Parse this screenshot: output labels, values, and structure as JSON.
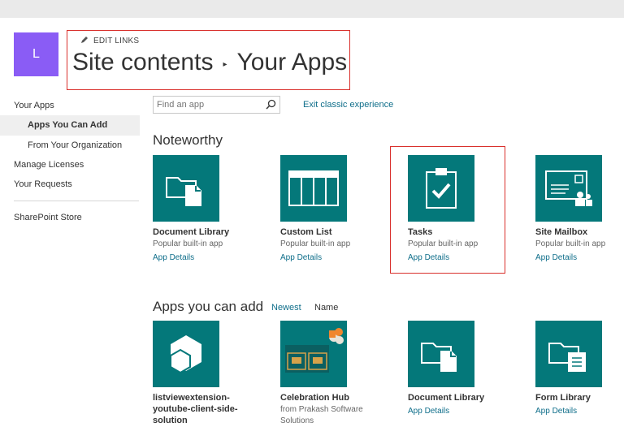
{
  "site": {
    "logo_letter": "L"
  },
  "header": {
    "edit_links": "EDIT LINKS",
    "breadcrumb_root": "Site contents",
    "breadcrumb_separator": "▸",
    "breadcrumb_current": "Your Apps"
  },
  "leftnav": {
    "items": [
      {
        "label": "Your Apps"
      },
      {
        "label": "Apps You Can Add"
      },
      {
        "label": "From Your Organization"
      },
      {
        "label": "Manage Licenses"
      },
      {
        "label": "Your Requests"
      },
      {
        "label": "SharePoint Store"
      }
    ]
  },
  "search": {
    "placeholder": "Find an app"
  },
  "exit_classic": "Exit classic experience",
  "noteworthy": {
    "heading": "Noteworthy",
    "apps": [
      {
        "name": "Document Library",
        "desc": "Popular built-in app",
        "details": "App Details",
        "icon": "document-library-icon"
      },
      {
        "name": "Custom List",
        "desc": "Popular built-in app",
        "details": "App Details",
        "icon": "custom-list-icon"
      },
      {
        "name": "Tasks",
        "desc": "Popular built-in app",
        "details": "App Details",
        "icon": "tasks-icon"
      },
      {
        "name": "Site Mailbox",
        "desc": "Popular built-in app",
        "details": "App Details",
        "icon": "site-mailbox-icon"
      }
    ]
  },
  "apps_you_can_add": {
    "heading": "Apps you can add",
    "sort_newest": "Newest",
    "sort_name": "Name",
    "apps": [
      {
        "name": "listviewextension-youtube-client-side-solution",
        "icon": "cube-icon"
      },
      {
        "name": "Celebration Hub",
        "desc": "from Prakash Software Solutions",
        "icon": "celebration-hub-icon"
      },
      {
        "name": "Document Library",
        "details": "App Details",
        "icon": "document-library-icon"
      },
      {
        "name": "Form Library",
        "details": "App Details",
        "icon": "form-library-icon"
      }
    ]
  },
  "colors": {
    "tile": "#04787a",
    "link": "#0f6e8a",
    "logo": "#8a5cf5",
    "highlight": "#d9302c"
  }
}
